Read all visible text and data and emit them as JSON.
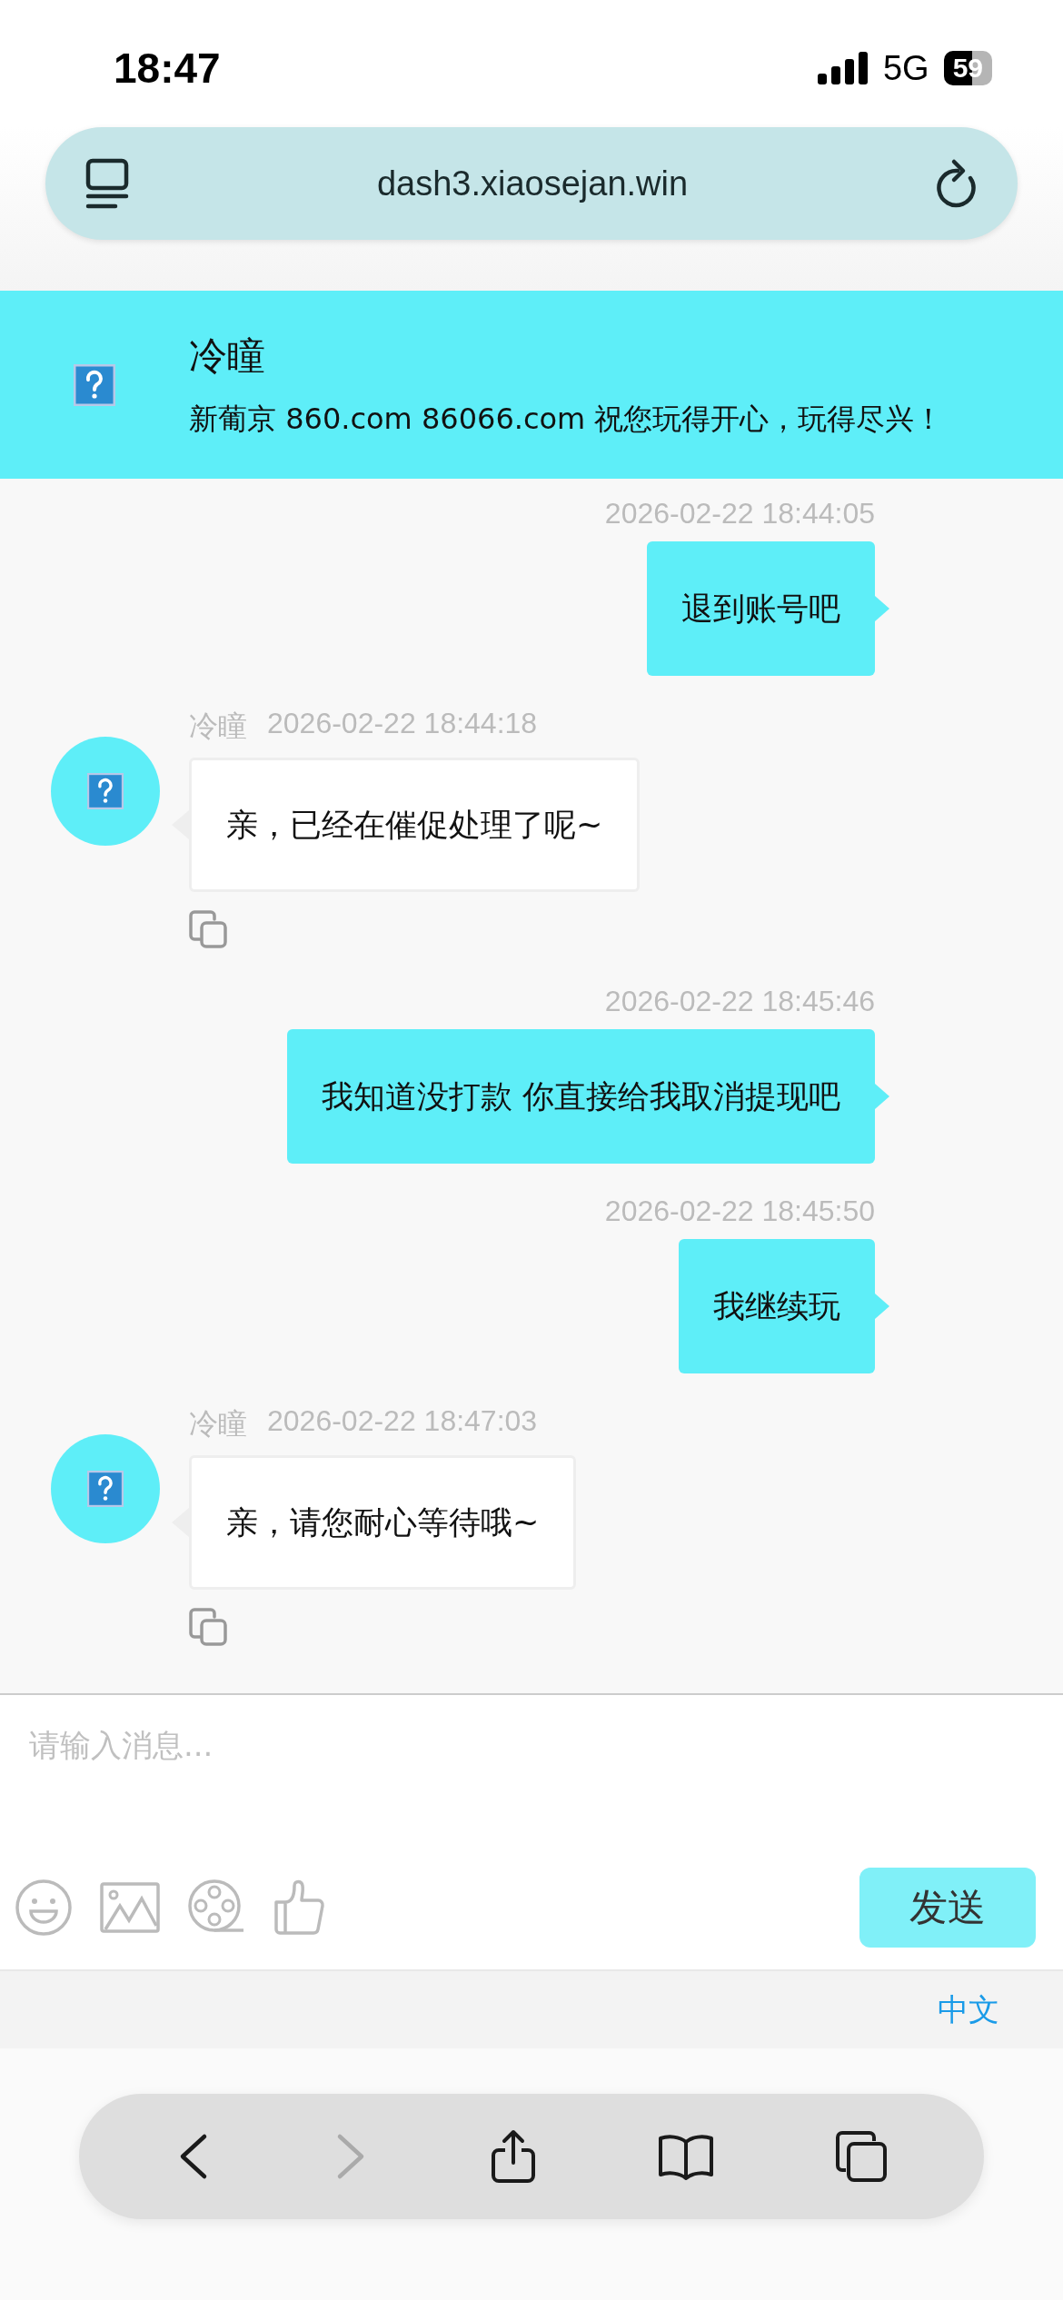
{
  "status_bar": {
    "time": "18:47",
    "network": "5G",
    "battery": "59"
  },
  "address_bar": {
    "url": "dash3.xiaosejan.win"
  },
  "chat_header": {
    "name": "冷瞳",
    "subtitle": "新葡京 860.com 86066.com 祝您玩得开心，玩得尽兴！"
  },
  "messages": [
    {
      "kind": "sent",
      "time": "2026-02-22 18:44:05",
      "text": "退到账号吧"
    },
    {
      "kind": "received",
      "sender": "冷瞳",
      "time": "2026-02-22 18:44:18",
      "text": "亲，已经在催促处理了呢~"
    },
    {
      "kind": "sent",
      "time": "2026-02-22 18:45:46",
      "text": "我知道没打款 你直接给我取消提现吧"
    },
    {
      "kind": "sent",
      "time": "2026-02-22 18:45:50",
      "text": "我继续玩"
    },
    {
      "kind": "received",
      "sender": "冷瞳",
      "time": "2026-02-22 18:47:03",
      "text": "亲，请您耐心等待哦~"
    }
  ],
  "composer": {
    "placeholder": "请输入消息...",
    "send": "发送"
  },
  "language": "中文",
  "browser_toolbar": [
    {
      "kind": "back",
      "disabled": false
    },
    {
      "kind": "forward",
      "disabled": true
    },
    {
      "kind": "share",
      "disabled": false
    },
    {
      "kind": "bookmarks",
      "disabled": false
    },
    {
      "kind": "tabs",
      "disabled": false
    }
  ]
}
